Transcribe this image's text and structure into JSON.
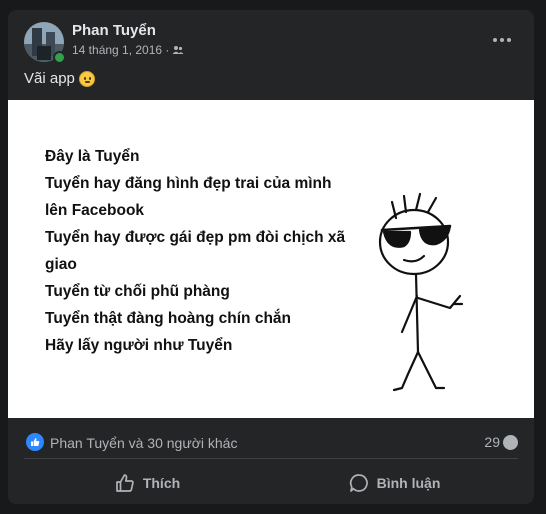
{
  "post": {
    "author": "Phan Tuyển",
    "date": "14 tháng 1, 2016 ·",
    "audience_icon": "friends-icon",
    "caption": "Vãi app",
    "caption_emoji": "smiley-emoji-icon",
    "image_text": [
      "Đây là Tuyển",
      "Tuyển hay đăng hình đẹp trai của mình",
      "lên Facebook",
      "Tuyển hay được gái đẹp pm đòi chịch xã",
      "giao",
      "Tuyển từ chối phũ phàng",
      "Tuyển thật đàng hoàng chín chắn",
      "Hãy lấy người như Tuyển"
    ],
    "reactions": "Phan Tuyển và 30 người khác",
    "comment_count": "29"
  },
  "actions": {
    "like_label": "Thích",
    "comment_label": "Bình luận"
  },
  "colors": {
    "background": "#18191a",
    "card": "#242526",
    "accent": "#2d88ff",
    "online": "#31a24c"
  }
}
